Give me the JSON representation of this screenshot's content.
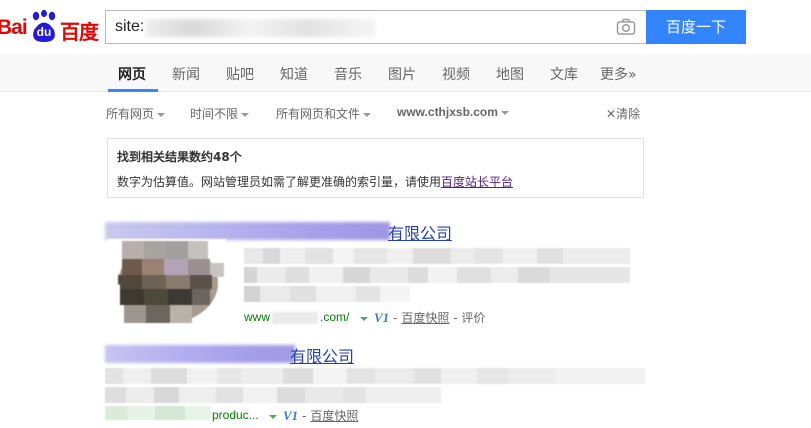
{
  "header": {
    "logo": {
      "left": "Bai",
      "paw": "du",
      "right": "百度"
    },
    "search_query": "site:",
    "search_button": "百度一下"
  },
  "tabs": [
    "网页",
    "新闻",
    "贴吧",
    "知道",
    "音乐",
    "图片",
    "视频",
    "地图",
    "文库",
    "更多»"
  ],
  "filters": {
    "all_pages": "所有网页",
    "time": "时间不限",
    "file_type": "所有网页和文件",
    "site": "www.cthjxsb.com",
    "clear": "清除"
  },
  "info": {
    "count_line": "找到相关结果数约48个",
    "note": "数字为估算值。网站管理员如需了解更准确的索引量，请使用",
    "link": "百度站长平台"
  },
  "results": [
    {
      "title_visible": "有限公司",
      "url": "www",
      "url_tail": ".com/",
      "cache": "百度快照",
      "separator": "-",
      "review": "评价"
    },
    {
      "title_visible": "有限公司",
      "url_tail": "produc...",
      "separator": "-",
      "cache": "百度快照"
    }
  ],
  "colors": {
    "accent": "#3385ff",
    "link": "#2440b3",
    "url": "#008000",
    "brand_red": "#e10601"
  }
}
